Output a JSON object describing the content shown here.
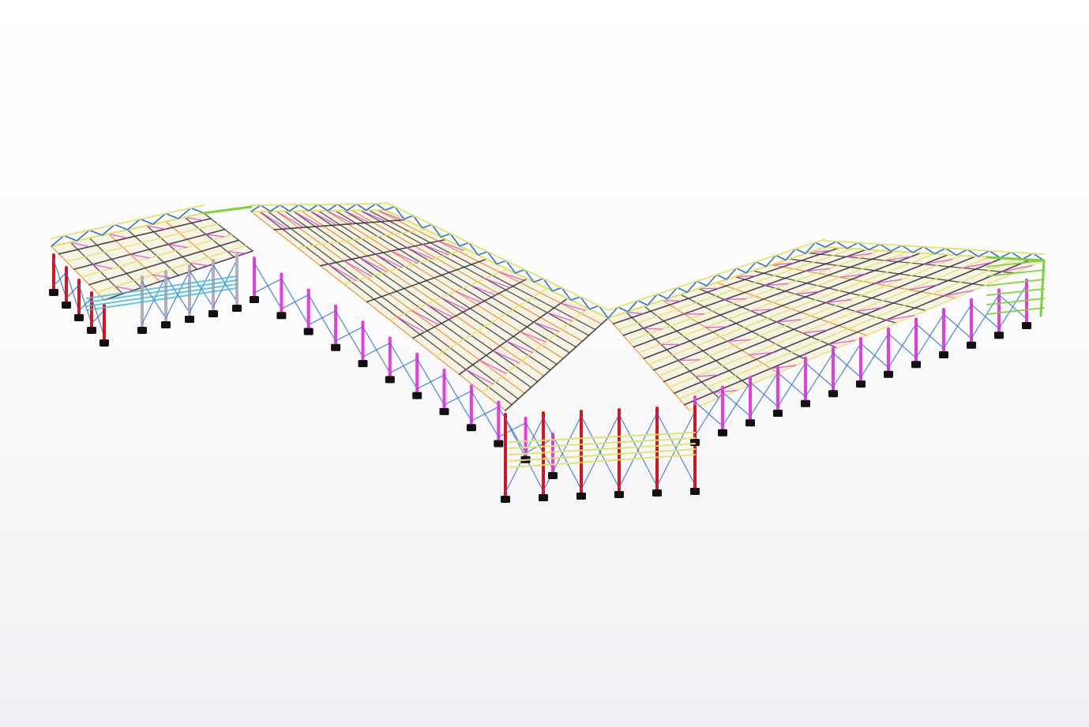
{
  "scene": {
    "subject": "3d-steel-structure-model",
    "colors": {
      "background_top": "#ffffff",
      "background_bottom": "#f0f0f4",
      "column": "#d7141a",
      "truss_chord": "#e3e36a",
      "bracing": "#2c6fe0",
      "secondary_member": "#e63ce0",
      "purlin_dark": "#333333",
      "purlin_orange": "#e38b2a",
      "gable_end": "#7fd13b",
      "rafter_cyan": "#3fb8d6",
      "column_grey": "#b8aeb8",
      "footing": "#111111"
    }
  }
}
